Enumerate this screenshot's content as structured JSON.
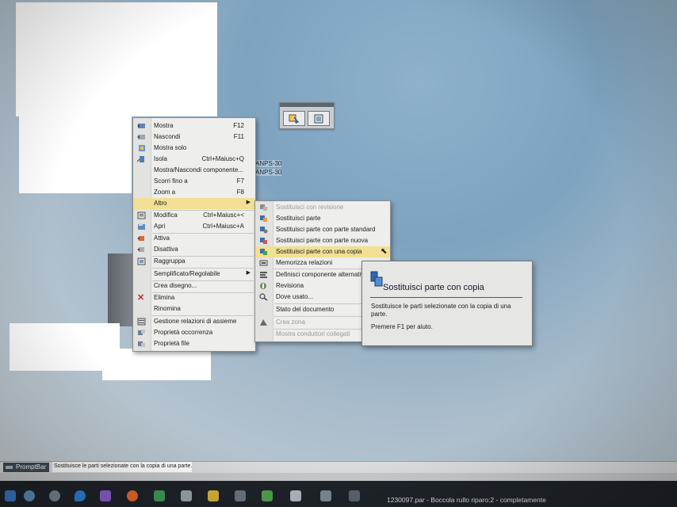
{
  "context_menu": {
    "items": [
      {
        "label": "Mostra",
        "shortcut": "F12",
        "icon": "show-icon"
      },
      {
        "label": "Nascondi",
        "shortcut": "F11",
        "icon": "hide-icon"
      },
      {
        "label": "Mostra solo",
        "shortcut": "",
        "icon": "show-only-icon"
      },
      {
        "label": "Isola",
        "shortcut": "Ctrl+Maiusc+Q",
        "icon": "isolate-icon"
      },
      {
        "label": "Mostra/Nascondi componente...",
        "shortcut": "",
        "icon": ""
      },
      {
        "label": "Scorri fino a",
        "shortcut": "F7",
        "icon": ""
      },
      {
        "label": "Zoom a",
        "shortcut": "F8",
        "icon": ""
      },
      {
        "label": "Altro",
        "shortcut": "",
        "icon": "",
        "submenu": true,
        "highlighted": true
      },
      {
        "label": "Modifica",
        "shortcut": "Ctrl+Maiusc+<",
        "icon": "edit-icon"
      },
      {
        "label": "Apri",
        "shortcut": "Ctrl+Maiusc+A",
        "icon": "open-icon"
      },
      {
        "label": "Attiva",
        "shortcut": "",
        "icon": "activate-icon"
      },
      {
        "label": "Disattiva",
        "shortcut": "",
        "icon": "deactivate-icon"
      },
      {
        "label": "Raggruppa",
        "shortcut": "",
        "icon": "group-icon"
      },
      {
        "label": "Semplificato/Regolabile",
        "shortcut": "",
        "icon": "",
        "submenu": true
      },
      {
        "label": "Crea disegno...",
        "shortcut": "",
        "icon": ""
      },
      {
        "label": "Elimina",
        "shortcut": "",
        "icon": "delete-icon"
      },
      {
        "label": "Rinomina",
        "shortcut": "",
        "icon": ""
      },
      {
        "label": "Gestione relazioni di assieme",
        "shortcut": "",
        "icon": "relations-icon"
      },
      {
        "label": "Proprietà occorrenza",
        "shortcut": "",
        "icon": "occurrence-properties-icon"
      },
      {
        "label": "Proprietà file",
        "shortcut": "",
        "icon": "file-properties-icon"
      }
    ]
  },
  "submenu": {
    "items": [
      {
        "label": "Sostituisci con revisione",
        "disabled": true,
        "icon": "replace-revision-icon"
      },
      {
        "label": "Sostituisci parte",
        "icon": "replace-part-icon"
      },
      {
        "label": "Sostituisci parte con parte standard",
        "icon": "replace-standard-icon"
      },
      {
        "label": "Sostituisci parte con parte nuova",
        "icon": "replace-new-icon"
      },
      {
        "label": "Sostituisci parte con una copia",
        "icon": "replace-copy-icon",
        "highlighted": true
      },
      {
        "label": "Memorizza relazioni",
        "icon": "store-relations-icon"
      },
      {
        "label": "Definisci componente alternativo",
        "icon": "alternate-component-icon"
      },
      {
        "label": "Revisiona",
        "icon": "revise-icon"
      },
      {
        "label": "Dove usato...",
        "icon": "where-used-icon"
      },
      {
        "label": "Stato del documento",
        "icon": ""
      },
      {
        "label": "Crea zona",
        "disabled": true,
        "icon": "zone-icon"
      },
      {
        "label": "Mostra conduttori collegati",
        "disabled": true,
        "icon": ""
      }
    ]
  },
  "tooltip": {
    "title": "Sostituisci parte con copia",
    "body": "Sostituisce le parti selezionate con la copia di una parte.",
    "help": "Premere F1 per aiuto."
  },
  "part_labels": [
    "ANPS-30",
    "ANPS-30"
  ],
  "promptbar": {
    "label": "PromptBar",
    "message": "Sostituisce le parti selezionate con la copia di una parte."
  },
  "taskbar": {
    "window_title": "1230097.par - Boccola rullo riparo:2 - completamente"
  },
  "colors": {
    "highlight": "#f3df93",
    "viewport_blue": "#7ea3bf"
  }
}
